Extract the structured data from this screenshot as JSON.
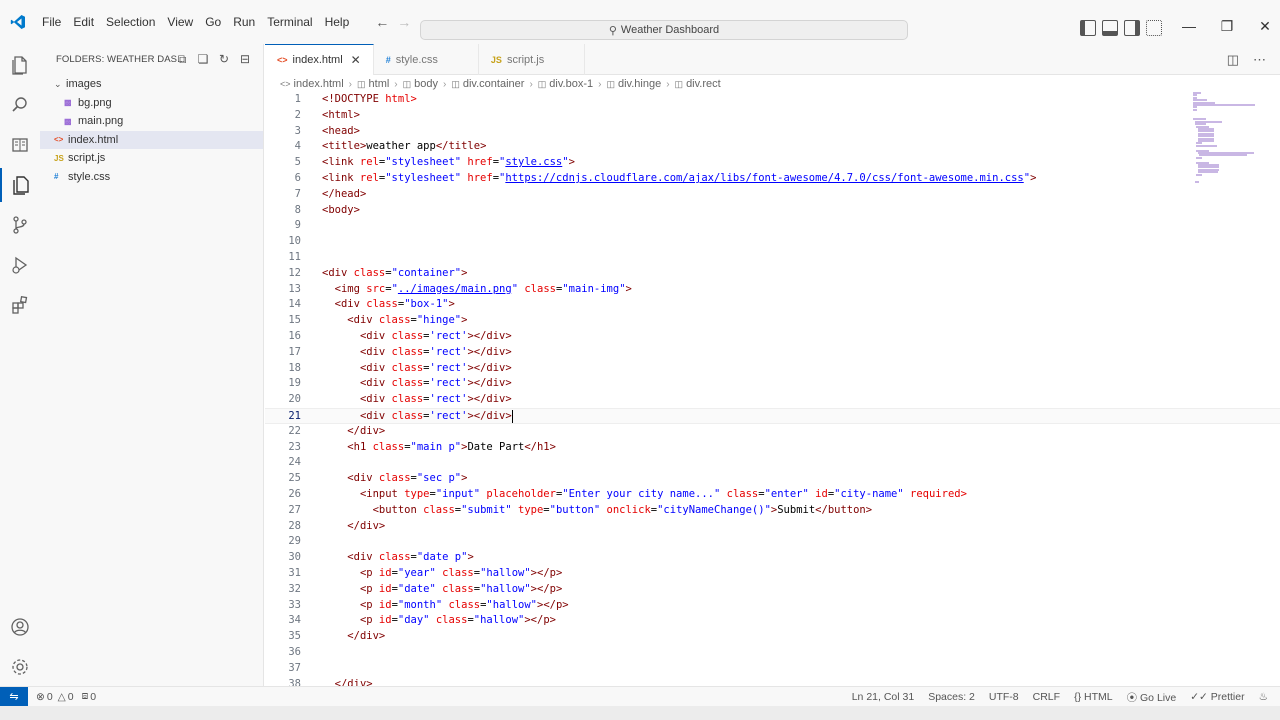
{
  "menu": [
    "File",
    "Edit",
    "Selection",
    "View",
    "Go",
    "Run",
    "Terminal",
    "Help"
  ],
  "command_center": "Weather Dashboard",
  "explorer": {
    "header": "FOLDERS: WEATHER DAS...",
    "items": [
      {
        "label": "images",
        "type": "folder"
      },
      {
        "label": "bg.png",
        "type": "img"
      },
      {
        "label": "main.png",
        "type": "img"
      },
      {
        "label": "index.html",
        "type": "html"
      },
      {
        "label": "script.js",
        "type": "js"
      },
      {
        "label": "style.css",
        "type": "css"
      }
    ]
  },
  "tabs": [
    {
      "label": "index.html",
      "active": true
    },
    {
      "label": "style.css",
      "active": false
    },
    {
      "label": "script.js",
      "active": false
    }
  ],
  "breadcrumb": [
    "index.html",
    "html",
    "body",
    "div.container",
    "div.box-1",
    "div.hinge",
    "div.rect"
  ],
  "code_lines": [
    {
      "n": "1",
      "text": "<!DOCTYPE html>"
    },
    {
      "n": "2",
      "text": "<html>"
    },
    {
      "n": "3",
      "text": "<head>"
    },
    {
      "n": "4",
      "text": "<title>weather app</title>"
    },
    {
      "n": "5",
      "text": "<link rel=\"stylesheet\" href=\"style.css\">"
    },
    {
      "n": "6",
      "text": "<link rel=\"stylesheet\" href=\"https://cdnjs.cloudflare.com/ajax/libs/font-awesome/4.7.0/css/font-awesome.min.css\">"
    },
    {
      "n": "7",
      "text": "</head>"
    },
    {
      "n": "8",
      "text": "<body>"
    },
    {
      "n": "9",
      "text": ""
    },
    {
      "n": "10",
      "text": ""
    },
    {
      "n": "11",
      "text": ""
    },
    {
      "n": "12",
      "text": "<div class=\"container\">"
    },
    {
      "n": "13",
      "text": "  <img src=\"../images/main.png\" class=\"main-img\">"
    },
    {
      "n": "14",
      "text": "  <div class=\"box-1\">"
    },
    {
      "n": "15",
      "text": "    <div class=\"hinge\">"
    },
    {
      "n": "16",
      "text": "      <div class='rect'></div>"
    },
    {
      "n": "17",
      "text": "      <div class='rect'></div>"
    },
    {
      "n": "18",
      "text": "      <div class='rect'></div>"
    },
    {
      "n": "19",
      "text": "      <div class='rect'></div>"
    },
    {
      "n": "20",
      "text": "      <div class='rect'></div>"
    },
    {
      "n": "21",
      "text": "      <div class='rect'></div>"
    },
    {
      "n": "22",
      "text": "    </div>"
    },
    {
      "n": "23",
      "text": "    <h1 class=\"main p\">Date Part</h1>"
    },
    {
      "n": "24",
      "text": ""
    },
    {
      "n": "25",
      "text": "    <div class=\"sec p\">"
    },
    {
      "n": "26",
      "text": "      <input type=\"input\" placeholder=\"Enter your city name...\" class=\"enter\" id=\"city-name\" required>"
    },
    {
      "n": "27",
      "text": "        <button class=\"submit\" type=\"button\" onclick=\"cityNameChange()\">Submit</button>"
    },
    {
      "n": "28",
      "text": "    </div>"
    },
    {
      "n": "29",
      "text": ""
    },
    {
      "n": "30",
      "text": "    <div class=\"date p\">"
    },
    {
      "n": "31",
      "text": "      <p id=\"year\" class=\"hallow\"></p>"
    },
    {
      "n": "32",
      "text": "      <p id=\"date\" class=\"hallow\"></p>"
    },
    {
      "n": "33",
      "text": "      <p id=\"month\" class=\"hallow\"></p>"
    },
    {
      "n": "34",
      "text": "      <p id=\"day\" class=\"hallow\"></p>"
    },
    {
      "n": "35",
      "text": "    </div>"
    },
    {
      "n": "36",
      "text": ""
    },
    {
      "n": "37",
      "text": ""
    },
    {
      "n": "38",
      "text": "  </div>"
    }
  ],
  "cursor_line": "21",
  "status": {
    "errors": "0",
    "warnings": "0",
    "ports": "0",
    "position": "Ln 21, Col 31",
    "spaces": "Spaces: 2",
    "encoding": "UTF-8",
    "eol": "CRLF",
    "language": "HTML",
    "go_live": "Go Live",
    "prettier": "Prettier"
  },
  "colors": {
    "accent": "#005fb8",
    "tag": "#800000",
    "attr": "#e50000",
    "value": "#0000ff"
  },
  "icons": [
    "explorer-icon",
    "search-icon",
    "source-control-icon",
    "run-debug-icon",
    "extensions-icon",
    "account-icon",
    "settings-gear-icon"
  ]
}
